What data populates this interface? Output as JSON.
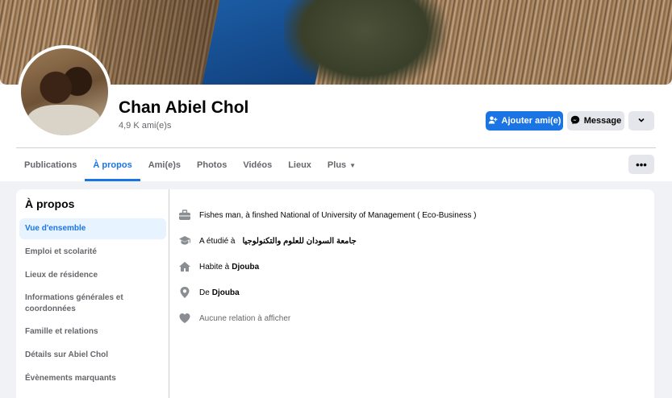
{
  "profile": {
    "name": "Chan Abiel Chol",
    "friends": "4,9 K ami(e)s"
  },
  "actions": {
    "add_friend": "Ajouter ami(e)",
    "message": "Message"
  },
  "tabs": [
    {
      "label": "Publications"
    },
    {
      "label": "À propos"
    },
    {
      "label": "Ami(e)s"
    },
    {
      "label": "Photos"
    },
    {
      "label": "Vidéos"
    },
    {
      "label": "Lieux"
    },
    {
      "label": "Plus"
    }
  ],
  "about": {
    "title": "À propos",
    "menu": [
      {
        "label": "Vue d'ensemble"
      },
      {
        "label": "Emploi et scolarité"
      },
      {
        "label": "Lieux de résidence"
      },
      {
        "label": "Informations générales et coordonnées"
      },
      {
        "label": "Famille et relations"
      },
      {
        "label": "Détails sur Abiel Chol"
      },
      {
        "label": "Évènements marquants"
      }
    ],
    "work": "Fishes man, à finshed National of University of Management ( Eco-Business )",
    "education_prefix": "A étudié à",
    "education_school": "جامعة السودان للعلوم والتكنولوجيا",
    "lives_prefix": "Habite à",
    "lives_city": "Djouba",
    "from_prefix": "De",
    "from_city": "Djouba",
    "relationship": "Aucune relation à afficher"
  },
  "icons": {
    "add_friend": "person-plus-icon",
    "message": "messenger-icon",
    "more": "chevron-down-icon",
    "dots": "ellipsis-icon",
    "work": "briefcase-icon",
    "education": "graduation-cap-icon",
    "home": "home-icon",
    "location": "location-pin-icon",
    "relationship": "heart-icon"
  },
  "colors": {
    "accent": "#1b74e4",
    "secondary_text": "#65676b",
    "button_gray": "#e4e6eb",
    "active_bg": "#e7f3ff"
  }
}
